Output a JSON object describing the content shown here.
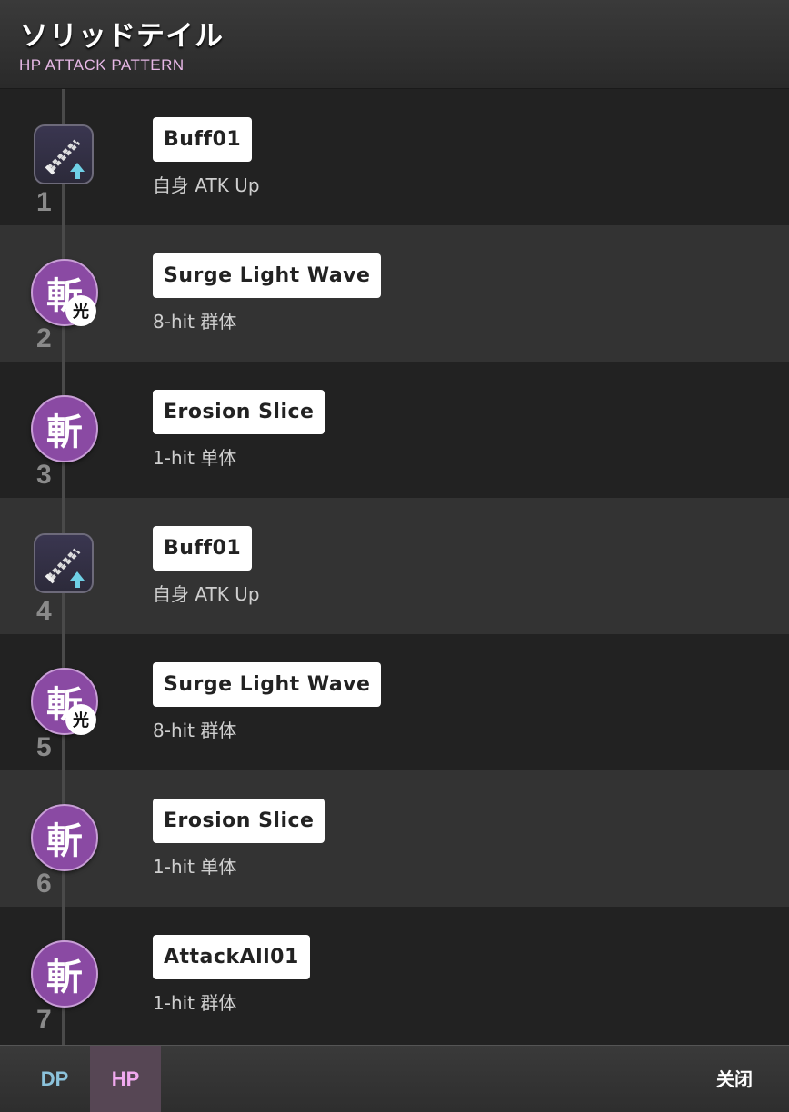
{
  "header": {
    "title": "ソリッドテイル",
    "subtitle": "HP ATTACK PATTERN"
  },
  "colors": {
    "slash_circle": "#8a4aa3",
    "hp_tab_text": "#f0a9ef",
    "dp_tab_text": "#8cc3dc",
    "subtitle": "#e7b8e6"
  },
  "moves": [
    {
      "number": "1",
      "name": "Buff01",
      "desc": "自身 ATK Up",
      "icon": "atk-up-buff-icon"
    },
    {
      "number": "2",
      "name": "Surge Light Wave",
      "desc": "8-hit 群体",
      "icon": "slash-light-icon",
      "icon_text": "斬",
      "badge_text": "光"
    },
    {
      "number": "3",
      "name": "Erosion Slice",
      "desc": "1-hit 单体",
      "icon": "slash-icon",
      "icon_text": "斬"
    },
    {
      "number": "4",
      "name": "Buff01",
      "desc": "自身 ATK Up",
      "icon": "atk-up-buff-icon"
    },
    {
      "number": "5",
      "name": "Surge Light Wave",
      "desc": "8-hit 群体",
      "icon": "slash-light-icon",
      "icon_text": "斬",
      "badge_text": "光"
    },
    {
      "number": "6",
      "name": "Erosion Slice",
      "desc": "1-hit 单体",
      "icon": "slash-icon",
      "icon_text": "斬"
    },
    {
      "number": "7",
      "name": "AttackAll01",
      "desc": "1-hit 群体",
      "icon": "slash-icon",
      "icon_text": "斬"
    }
  ],
  "footer": {
    "tab_dp": "DP",
    "tab_hp": "HP",
    "active_tab": "HP",
    "close_label": "关闭"
  }
}
